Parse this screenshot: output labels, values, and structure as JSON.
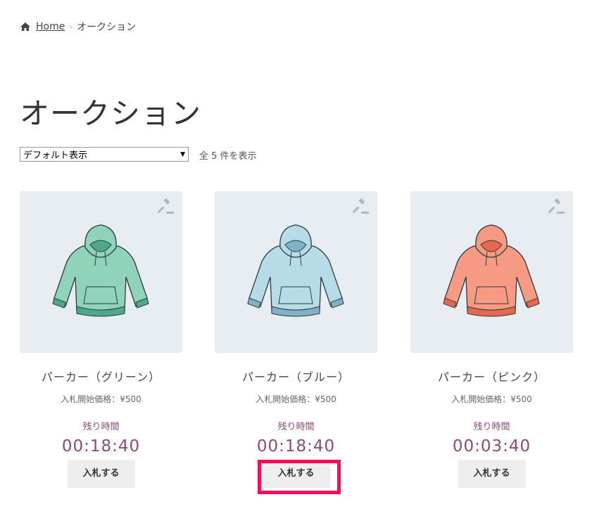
{
  "breadcrumb": {
    "home_label": "Home",
    "current": "オークション"
  },
  "page_title": "オークション",
  "sort": {
    "selected": "デフォルト表示"
  },
  "result_count": "全 5 件を表示",
  "products": [
    {
      "name": "パーカー（グリーン）",
      "price": "入札開始価格：¥500",
      "remain_label": "残り時間",
      "countdown": "00:18:40",
      "bid_label": "入札する",
      "color": "#8fd3bb",
      "dark": "#4fa88a"
    },
    {
      "name": "パーカー（ブルー）",
      "price": "入札開始価格：¥500",
      "remain_label": "残り時間",
      "countdown": "00:18:40",
      "bid_label": "入札する",
      "color": "#b8dbe8",
      "dark": "#7fb2c6"
    },
    {
      "name": "パーカー（ピンク）",
      "price": "入札開始価格：¥500",
      "remain_label": "残り時間",
      "countdown": "00:03:40",
      "bid_label": "入札する",
      "color": "#f79a84",
      "dark": "#e8674f"
    }
  ],
  "colors": {
    "accent": "#8a4a7a",
    "highlight": "#ff0a54",
    "thumb_bg": "#e8edf1"
  },
  "icons": {
    "home": "home-icon",
    "auction": "auction-hammer-icon",
    "product": "hoodie-image"
  }
}
